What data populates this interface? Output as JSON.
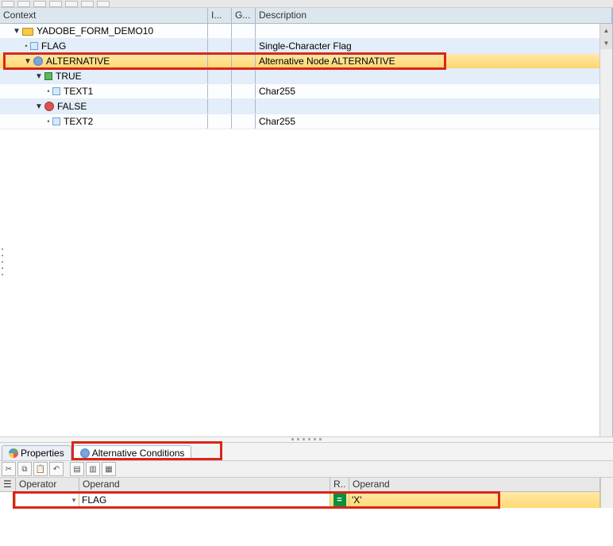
{
  "tree": {
    "columns": {
      "context": "Context",
      "i": "I...",
      "g": "G...",
      "description": "Description"
    },
    "nodes": [
      {
        "id": "root",
        "label": "YADOBE_FORM_DEMO10",
        "desc": "",
        "icon": "folder",
        "indent": 1,
        "expander": "▼",
        "bg": "light"
      },
      {
        "id": "flag",
        "label": "FLAG",
        "desc": "Single-Character Flag",
        "icon": "field",
        "indent": 2,
        "bullet": true,
        "bg": "blue"
      },
      {
        "id": "alt",
        "label": "ALTERNATIVE",
        "desc": "Alternative Node ALTERNATIVE",
        "icon": "alt",
        "indent": 2,
        "expander": "▼",
        "bg": "selected"
      },
      {
        "id": "true",
        "label": "TRUE",
        "desc": "",
        "icon": "true",
        "indent": 3,
        "expander": "▼",
        "bg": "blue"
      },
      {
        "id": "text1",
        "label": "TEXT1",
        "desc": "Char255",
        "icon": "text",
        "indent": 4,
        "bullet": true,
        "bg": "light"
      },
      {
        "id": "false",
        "label": "FALSE",
        "desc": "",
        "icon": "false",
        "indent": 3,
        "expander": "▼",
        "bg": "blue"
      },
      {
        "id": "text2",
        "label": "TEXT2",
        "desc": "Char255",
        "icon": "text",
        "indent": 4,
        "bullet": true,
        "bg": "light"
      }
    ]
  },
  "tabs": {
    "properties": "Properties",
    "alt_conditions": "Alternative Conditions"
  },
  "conditions": {
    "columns": {
      "operator": "Operator",
      "operand1": "Operand",
      "r": "R..",
      "operand2": "Operand"
    },
    "row": {
      "operator": "",
      "operand1": "FLAG",
      "relation": "=",
      "operand2": "'X'"
    }
  }
}
